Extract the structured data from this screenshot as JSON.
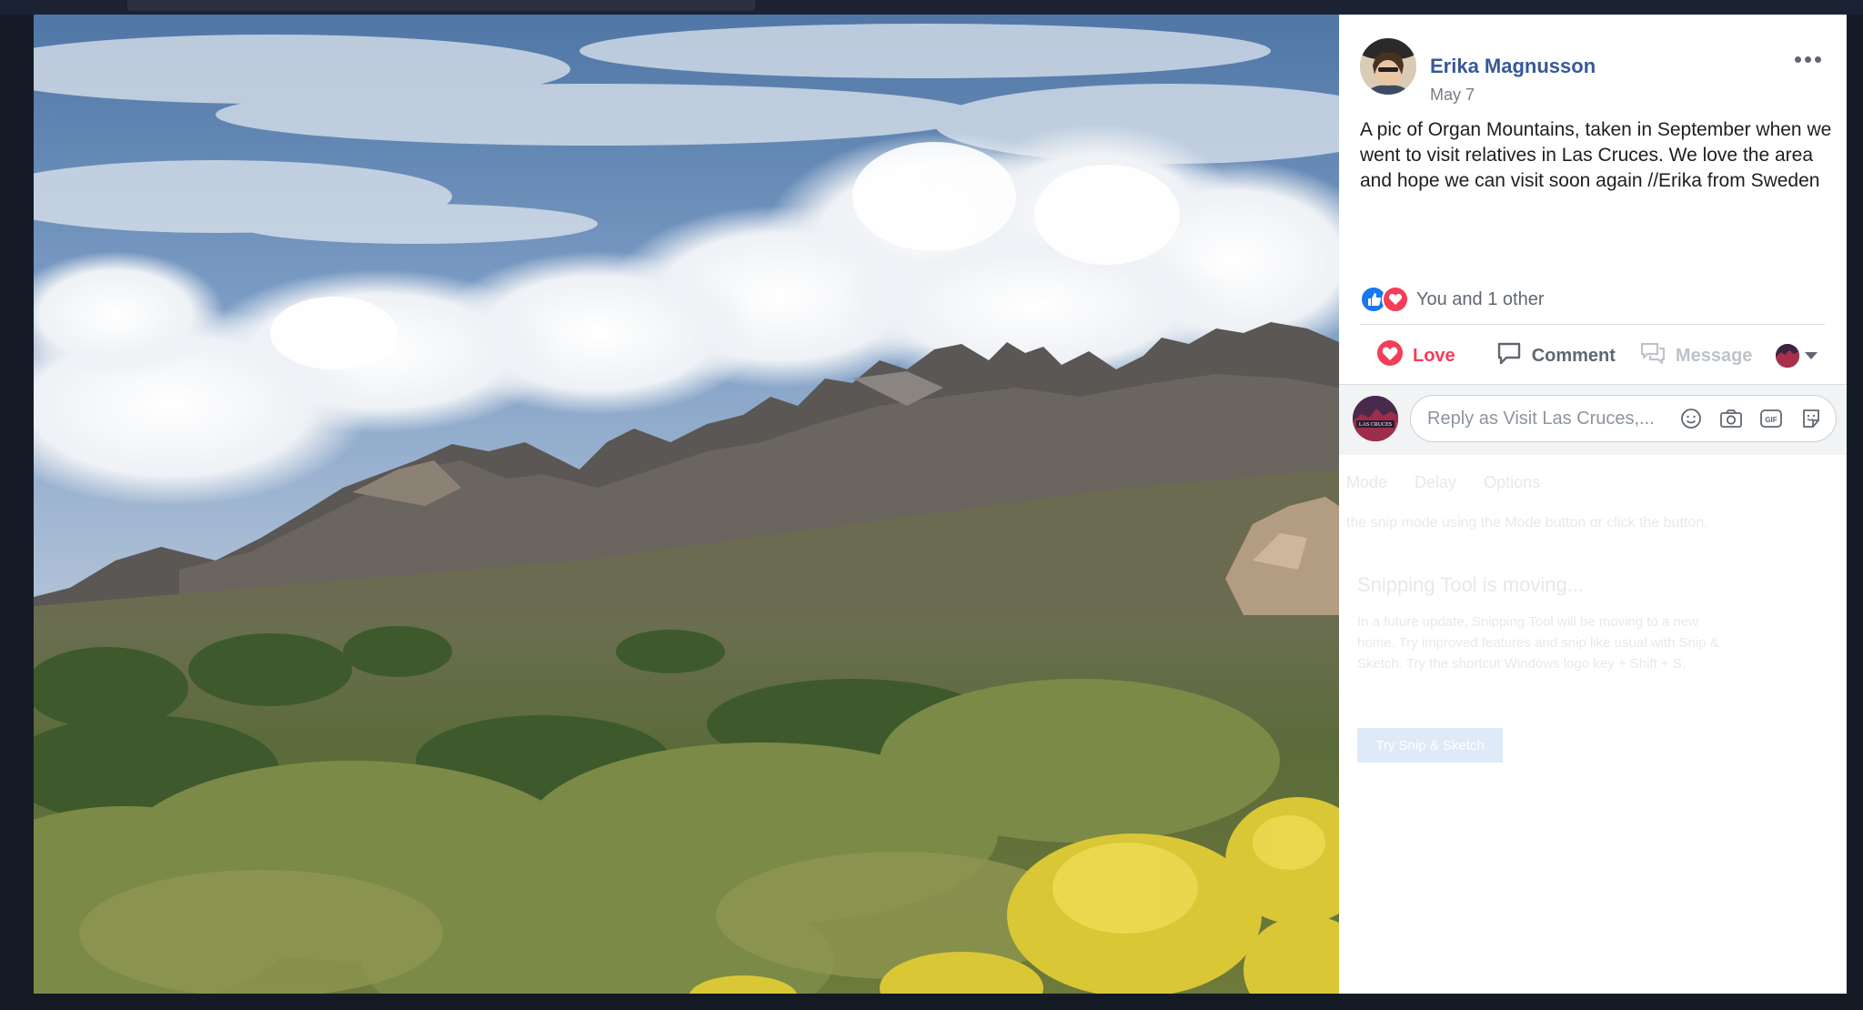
{
  "post": {
    "author": "Erika Magnusson",
    "date": "May 7",
    "text": "A pic of Organ Mountains, taken in September when we went to visit relatives in Las Cruces. We love the area and hope we can visit soon again //Erika from Sweden",
    "reactions_summary": "You and 1 other"
  },
  "actions": {
    "love": "Love",
    "comment": "Comment",
    "message": "Message"
  },
  "reply": {
    "placeholder": "Reply as Visit Las Cruces,..."
  },
  "page_avatar_text": "LAS CRUCES",
  "ghost": {
    "tabs": [
      "Mode",
      "Delay",
      "Options"
    ],
    "hint": "the snip mode using the Mode button or click the button.",
    "title": "Snipping Tool is moving...",
    "body": "In a future update, Snipping Tool will be moving to a new home. Try improved features and snip like usual with Snip & Sketch. Try the shortcut Windows logo key + Shift + S.",
    "button": "Try Snip & Sketch"
  },
  "colors": {
    "author_link": "#385898",
    "love": "#f33e58",
    "like": "#1877f2"
  }
}
